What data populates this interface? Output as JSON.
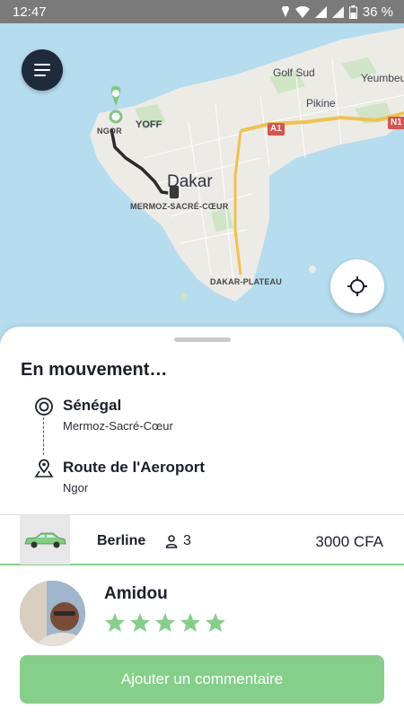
{
  "status_bar": {
    "time": "12:47",
    "battery": "36 %",
    "icons": [
      "location-icon",
      "wifi-icon",
      "signal-icon",
      "signal-icon",
      "battery-icon"
    ]
  },
  "map": {
    "labels": {
      "golf_sud": "Golf Sud",
      "yeumbeul": "Yeumbeul",
      "pikine": "Pikine",
      "yoff": "YOFF",
      "ngor": "NGOR",
      "dakar": "Dakar",
      "mermoz": "MERMOZ-SACRÉ-CŒUR",
      "plateau": "DAKAR-PLATEAU",
      "a1": "A1",
      "n1": "N1"
    },
    "colors": {
      "water": "#b6dcef",
      "land": "#ecebe6",
      "route": "#2b2b2b",
      "marker": "#7fc87f",
      "highway": "#f2c14e"
    }
  },
  "controls": {
    "menu_icon": "hamburger-icon",
    "locate_icon": "crosshair-icon"
  },
  "trip": {
    "status": "En mouvement…",
    "pickup": {
      "title": "Sénégal",
      "subtitle": "Mermoz-Sacré-Cœur",
      "icon": "target-icon"
    },
    "dropoff": {
      "title": "Route de l'Aeroport",
      "subtitle": "Ngor",
      "icon": "map-pin-icon"
    }
  },
  "vehicle": {
    "type": "Berline",
    "seats": "3",
    "price": "3000 CFA",
    "icon": "car-icon"
  },
  "driver": {
    "name": "Amidou",
    "rating": 5,
    "rating_max": 5
  },
  "actions": {
    "comment_label": "Ajouter un commentaire"
  },
  "colors": {
    "accent_green": "#86cf8a",
    "dark_button": "#1f2a3a"
  }
}
